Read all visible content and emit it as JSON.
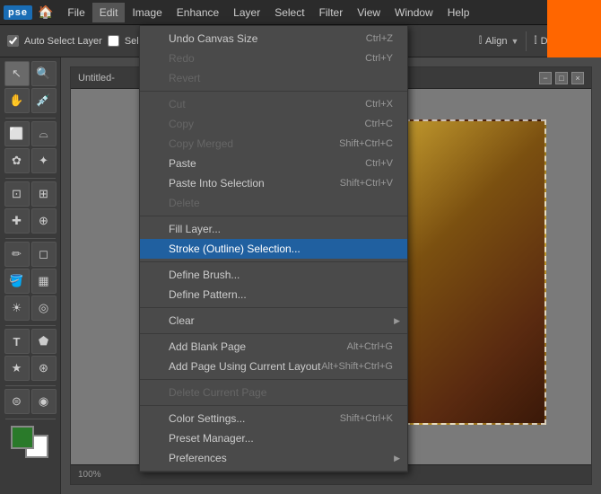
{
  "app": {
    "logo": "pse",
    "title": "Untitled-"
  },
  "menu_bar": {
    "items": [
      {
        "label": "File",
        "id": "file"
      },
      {
        "label": "Edit",
        "id": "edit",
        "active": true
      },
      {
        "label": "Image",
        "id": "image"
      },
      {
        "label": "Enhance",
        "id": "enhance"
      },
      {
        "label": "Layer",
        "id": "layer"
      },
      {
        "label": "Select",
        "id": "select"
      },
      {
        "label": "Filter",
        "id": "filter"
      },
      {
        "label": "View",
        "id": "view"
      },
      {
        "label": "Window",
        "id": "window"
      },
      {
        "label": "Help",
        "id": "help"
      }
    ]
  },
  "toolbar": {
    "auto_select_label": "Auto Select Layer",
    "select_label": "Select",
    "align_label": "Align",
    "distribute_label": "Distribute"
  },
  "edit_menu": {
    "sections": [
      {
        "items": [
          {
            "label": "Undo Canvas Size",
            "shortcut": "Ctrl+Z",
            "disabled": false
          },
          {
            "label": "Redo",
            "shortcut": "Ctrl+Y",
            "disabled": true
          },
          {
            "label": "Revert",
            "shortcut": "",
            "disabled": true
          }
        ]
      },
      {
        "items": [
          {
            "label": "Cut",
            "shortcut": "Ctrl+X",
            "disabled": true
          },
          {
            "label": "Copy",
            "shortcut": "Ctrl+C",
            "disabled": true
          },
          {
            "label": "Copy Merged",
            "shortcut": "Shift+Ctrl+C",
            "disabled": true
          },
          {
            "label": "Paste",
            "shortcut": "Ctrl+V",
            "disabled": false
          },
          {
            "label": "Paste Into Selection",
            "shortcut": "Shift+Ctrl+V",
            "disabled": false
          },
          {
            "label": "Delete",
            "shortcut": "",
            "disabled": true
          }
        ]
      },
      {
        "items": [
          {
            "label": "Fill Layer...",
            "shortcut": "",
            "disabled": false
          },
          {
            "label": "Stroke (Outline) Selection...",
            "shortcut": "",
            "disabled": false,
            "highlighted": true
          }
        ]
      },
      {
        "items": [
          {
            "label": "Define Brush...",
            "shortcut": "",
            "disabled": false
          },
          {
            "label": "Define Pattern...",
            "shortcut": "",
            "disabled": false
          }
        ]
      },
      {
        "items": [
          {
            "label": "Clear",
            "shortcut": "",
            "has_submenu": true,
            "disabled": false
          }
        ]
      },
      {
        "items": [
          {
            "label": "Add Blank Page",
            "shortcut": "Alt+Ctrl+G",
            "disabled": false
          },
          {
            "label": "Add Page Using Current Layout",
            "shortcut": "Alt+Shift+Ctrl+G",
            "disabled": false
          }
        ]
      },
      {
        "items": [
          {
            "label": "Delete Current Page",
            "shortcut": "",
            "disabled": true
          }
        ]
      },
      {
        "items": [
          {
            "label": "Color Settings...",
            "shortcut": "Shift+Ctrl+K",
            "disabled": false
          },
          {
            "label": "Preset Manager...",
            "shortcut": "",
            "disabled": false
          },
          {
            "label": "Preferences",
            "shortcut": "",
            "has_submenu": true,
            "disabled": false
          }
        ]
      }
    ]
  },
  "status": {
    "zoom": "100%"
  }
}
